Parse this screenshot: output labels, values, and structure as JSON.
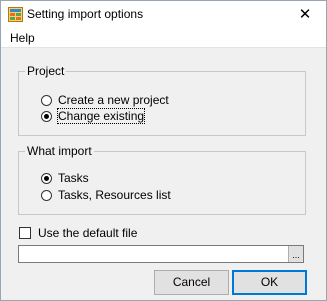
{
  "window": {
    "title": "Setting import options",
    "close_glyph": "✕"
  },
  "menu": {
    "items": [
      "Help"
    ]
  },
  "project_group": {
    "legend": "Project",
    "options": [
      {
        "label": "Create a new project",
        "checked": false
      },
      {
        "label": "Change existing",
        "checked": true
      }
    ]
  },
  "what_import_group": {
    "legend": "What import",
    "options": [
      {
        "label": "Tasks",
        "checked": true
      },
      {
        "label": "Tasks, Resources list",
        "checked": false
      }
    ]
  },
  "default_file": {
    "label": "Use the default file",
    "checked": false,
    "path_value": "",
    "browse_label": "..."
  },
  "buttons": {
    "cancel": "Cancel",
    "ok": "OK"
  },
  "colors": {
    "accent": "#0078d7",
    "window_bg": "#f0f0f0"
  },
  "icons": {
    "app": "app-grid-icon"
  }
}
